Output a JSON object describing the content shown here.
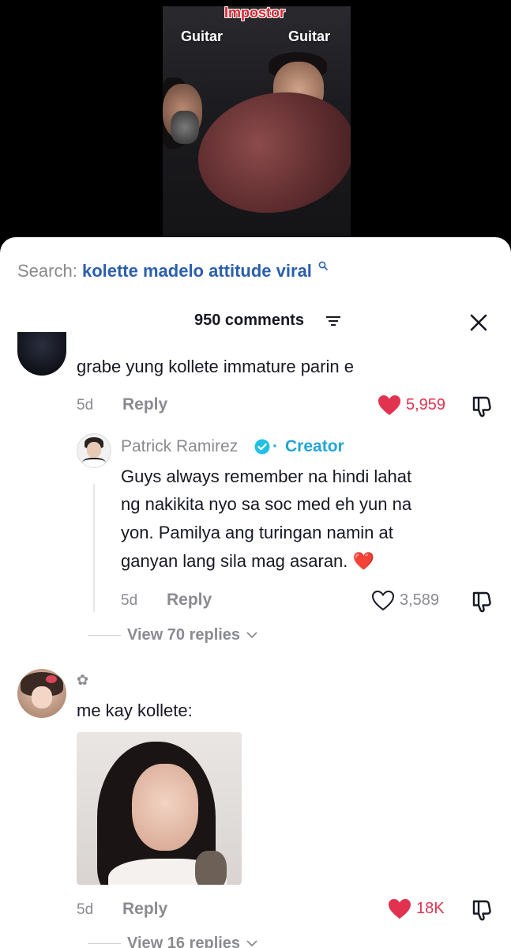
{
  "video": {
    "overlay_title": "Impostor",
    "label_left": "Guitar",
    "label_right": "Guitar"
  },
  "search": {
    "prefix": "Search:",
    "query": "kolette madelo attitude viral"
  },
  "comments_header": {
    "count_label": "950 comments"
  },
  "comments": [
    {
      "text": "grabe yung kollete immature parin e",
      "time": "5d",
      "reply_label": "Reply",
      "likes": "5,959",
      "liked": true
    },
    {
      "author": "Patrick Ramirez",
      "separator": "·",
      "badge": "Creator",
      "lines": [
        "Guys always remember na hindi lahat",
        "ng nakikita nyo sa soc med eh yun na",
        "yon. Pamilya ang turingan namin at",
        "ganyan lang sila mag asaran. ❤️"
      ],
      "time": "5d",
      "reply_label": "Reply",
      "likes": "3,589",
      "liked": false
    },
    {
      "view_replies": "View 70 replies"
    },
    {
      "author": "✿",
      "text": "me kay kollete:",
      "time": "5d",
      "reply_label": "Reply",
      "likes": "18K",
      "liked": true,
      "view_replies": "View 16 replies"
    }
  ],
  "colors": {
    "like_active": "#e1324f",
    "creator": "#23a6d5",
    "search_query": "#2b5fad"
  }
}
